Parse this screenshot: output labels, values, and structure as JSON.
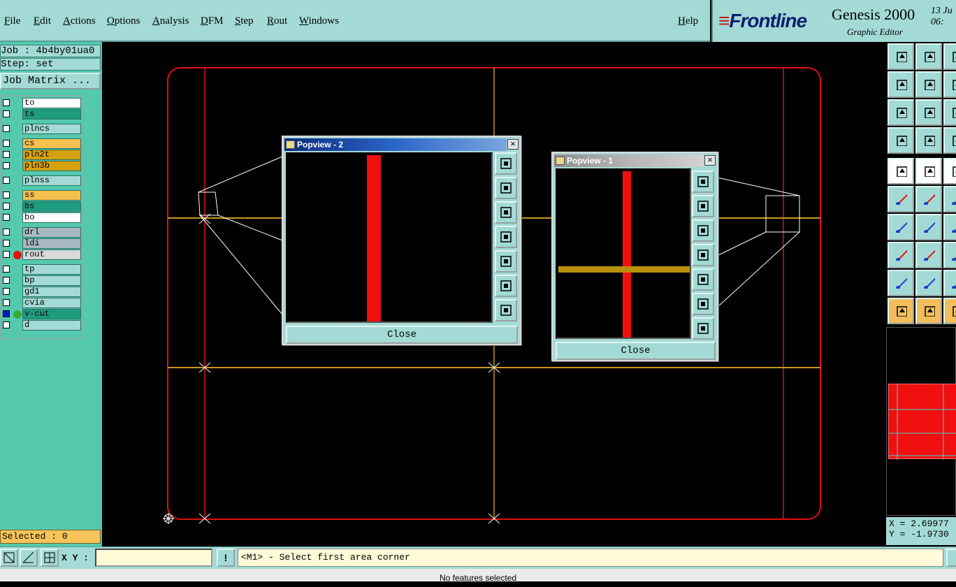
{
  "menu": {
    "file": "File",
    "edit": "Edit",
    "actions": "Actions",
    "options": "Options",
    "analysis": "Analysis",
    "dfm": "DFM",
    "step": "Step",
    "rout": "Rout",
    "windows": "Windows",
    "help": "Help"
  },
  "brand": {
    "logo": "Frontline",
    "title": "Genesis 2000",
    "subtitle": "Graphic Editor",
    "date_line1": "13 Ju",
    "date_line2": "06:"
  },
  "job": {
    "job_label": "Job : 4b4by01ua0",
    "step_label": "Step: set",
    "matrix_button": "Job Matrix ..."
  },
  "layers": [
    {
      "name": "to",
      "color": "#ffffff"
    },
    {
      "name": "ts",
      "color": "#1e9c7e"
    },
    {
      "name": "plncs",
      "color": "#a3dad6"
    },
    {
      "name": "cs",
      "color": "#f6c04e"
    },
    {
      "name": "pln2t",
      "color": "#d6a10e"
    },
    {
      "name": "pln3b",
      "color": "#d6a10e"
    },
    {
      "name": "plnss",
      "color": "#a3dad6"
    },
    {
      "name": "ss",
      "color": "#f6c04e"
    },
    {
      "name": "bs",
      "color": "#1e9c7e"
    },
    {
      "name": "bo",
      "color": "#ffffff"
    },
    {
      "name": "drl",
      "color": "#a9b9c1"
    },
    {
      "name": "ldi",
      "color": "#a9b9c1"
    },
    {
      "name": "rout",
      "color": "#d8d8d8"
    },
    {
      "name": "tp",
      "color": "#a3dad6"
    },
    {
      "name": "bp",
      "color": "#a3dad6"
    },
    {
      "name": "gd1",
      "color": "#a3dad6"
    },
    {
      "name": "cvia",
      "color": "#a3dad6"
    },
    {
      "name": "v-cut",
      "color": "#1e9c7e"
    },
    {
      "name": "d",
      "color": "#a3dad6"
    }
  ],
  "selected_label": "Selected : 0",
  "popview2": {
    "title": "Popview - 2",
    "close": "Close",
    "close_x": "×"
  },
  "popview1": {
    "title": "Popview - 1",
    "close": "Close",
    "close_x": "×"
  },
  "coords": {
    "x": "X = 2.69977",
    "y": "Y = -1.9730"
  },
  "bottom": {
    "xy_label": "X Y :",
    "xy_value": "",
    "info_button": "!",
    "prompt": "<M1> - Select first area corner"
  },
  "status": "No features selected",
  "colors": {
    "panel": "#a3dad6",
    "left_panel": "#55c9ad",
    "profile": "#e01010",
    "vcut": "#c8961e",
    "highlight": "#f7c45a"
  }
}
